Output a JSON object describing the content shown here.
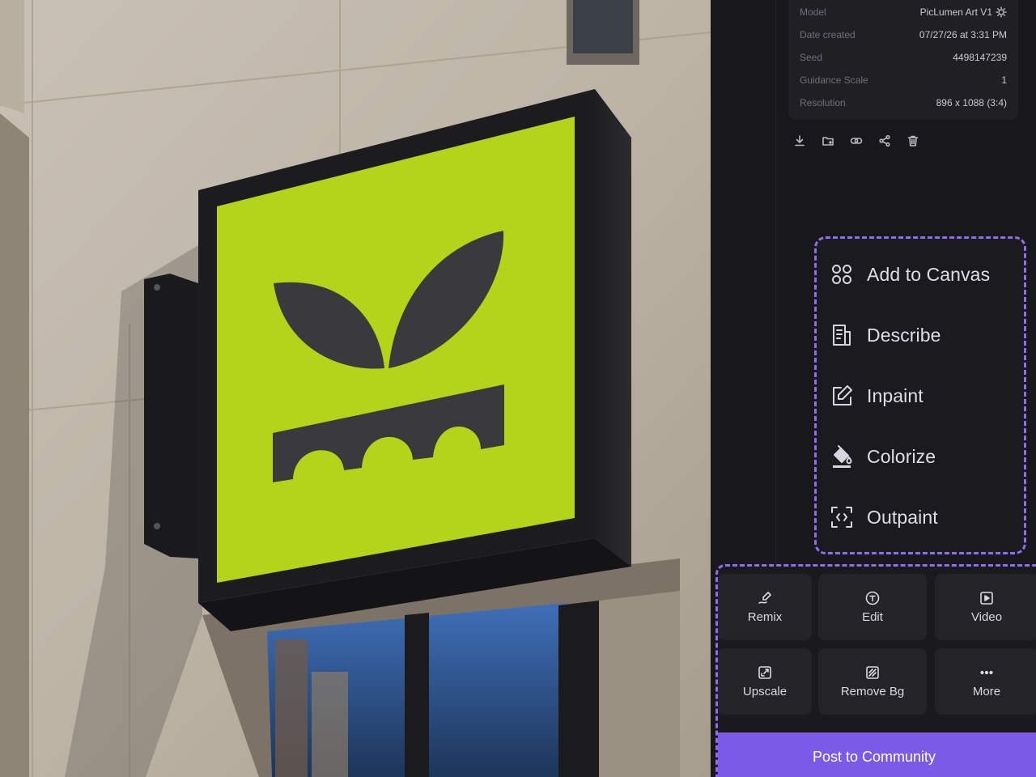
{
  "photo": {
    "description_icon": "signboard-photo",
    "sign_color": "#b4d41c"
  },
  "details": {
    "rows": [
      {
        "label": "Model",
        "value": "PicLumen Art V1"
      },
      {
        "label": "Date created",
        "value": "07/27/26 at 3:31 PM"
      },
      {
        "label": "Seed",
        "value": "4498147239"
      },
      {
        "label": "Guidance Scale",
        "value": "1"
      },
      {
        "label": "Resolution",
        "value": "896 x 1088 (3:4)"
      }
    ],
    "model_badge_icon": "gear-icon"
  },
  "toolbar": {
    "icons": [
      "download-icon",
      "add-to-folder-icon",
      "link-icon",
      "share-icon",
      "trash-icon"
    ]
  },
  "menu": {
    "items": [
      {
        "label": "Add to Canvas",
        "icon": "canvas-icon"
      },
      {
        "label": "Describe",
        "icon": "describe-icon"
      },
      {
        "label": "Inpaint",
        "icon": "inpaint-icon"
      },
      {
        "label": "Colorize",
        "icon": "colorize-icon"
      },
      {
        "label": "Outpaint",
        "icon": "outpaint-icon"
      }
    ]
  },
  "actions": {
    "buttons": [
      {
        "label": "Remix",
        "icon": "remix-icon"
      },
      {
        "label": "Edit",
        "icon": "edit-icon"
      },
      {
        "label": "Video",
        "icon": "video-icon"
      },
      {
        "label": "Upscale",
        "icon": "upscale-icon"
      },
      {
        "label": "Remove Bg",
        "icon": "remove-bg-icon"
      },
      {
        "label": "More",
        "icon": "more-icon"
      }
    ],
    "post_label": "Post to Community"
  },
  "colors": {
    "accent": "#8f6cf2",
    "post_button": "#7c5ae8",
    "panel_bg": "#18181b"
  }
}
